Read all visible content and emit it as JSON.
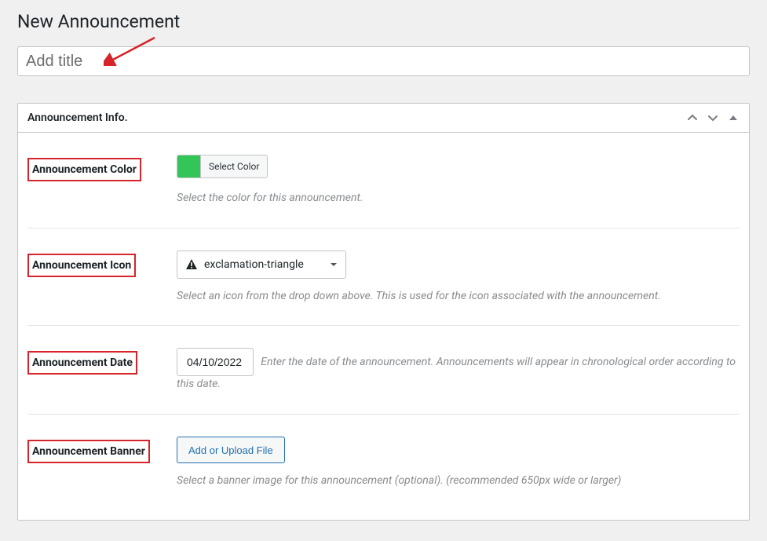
{
  "page": {
    "title": "New Announcement",
    "title_placeholder": "Add title"
  },
  "panel": {
    "title": "Announcement Info."
  },
  "fields": {
    "color": {
      "label": "Announcement Color",
      "button": "Select Color",
      "swatch": "#34c559",
      "hint": "Select the color for this announcement."
    },
    "icon": {
      "label": "Announcement Icon",
      "selected": "exclamation-triangle",
      "hint": "Select an icon from the drop down above. This is used for the icon associated with the announcement."
    },
    "date": {
      "label": "Announcement Date",
      "value": "04/10/2022",
      "hint": "Enter the date of the announcement. Announcements will appear in chronological order according to this date."
    },
    "banner": {
      "label": "Announcement Banner",
      "button": "Add or Upload File",
      "hint": "Select a banner image for this announcement (optional). (recommended 650px wide or larger)"
    }
  }
}
